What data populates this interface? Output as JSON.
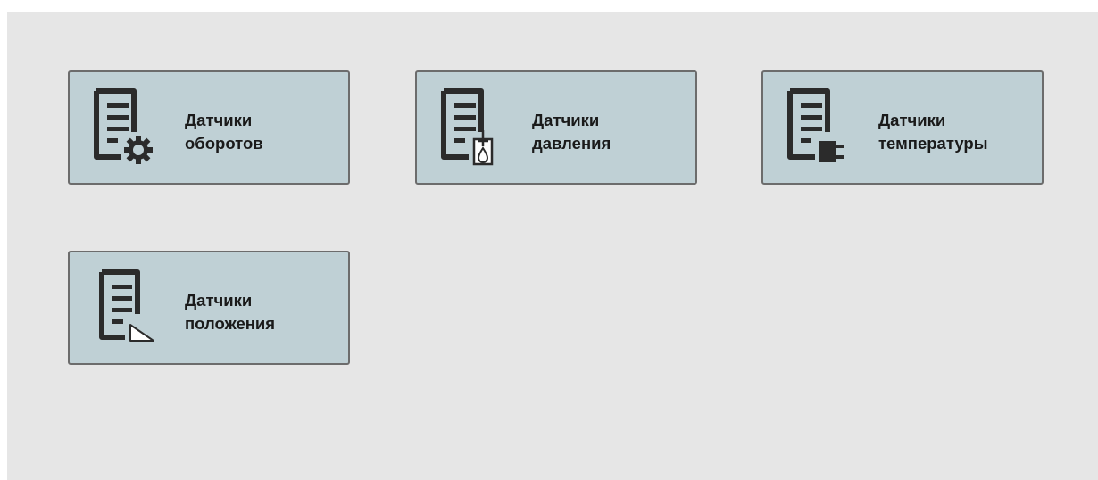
{
  "tiles": [
    {
      "line1": "Датчики",
      "line2": "оборотов",
      "icon": "document-gear-icon"
    },
    {
      "line1": "Датчики",
      "line2": "давления",
      "icon": "document-pressure-gauge-icon"
    },
    {
      "line1": "Датчики",
      "line2": "температуры",
      "icon": "document-plug-icon"
    },
    {
      "line1": "Датчики",
      "line2": "положения",
      "icon": "document-triangle-icon"
    }
  ],
  "colors": {
    "background": "#e6e6e6",
    "tile_fill": "#bfd0d5",
    "tile_border": "#6c6c6c",
    "icon": "#2b2b2b",
    "text": "#1a1a1a"
  }
}
